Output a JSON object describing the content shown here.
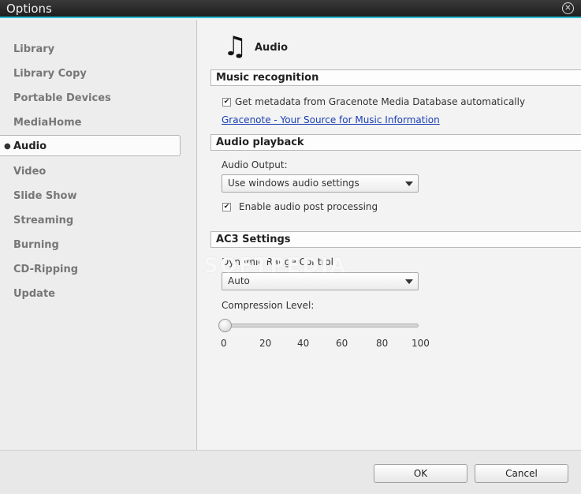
{
  "window": {
    "title": "Options",
    "close_glyph": "✕"
  },
  "sidebar": {
    "items": [
      {
        "label": "Library"
      },
      {
        "label": "Library Copy"
      },
      {
        "label": "Portable Devices"
      },
      {
        "label": "MediaHome"
      },
      {
        "label": "Audio",
        "active": true
      },
      {
        "label": "Video"
      },
      {
        "label": "Slide Show"
      },
      {
        "label": "Streaming"
      },
      {
        "label": "Burning"
      },
      {
        "label": "CD-Ripping"
      },
      {
        "label": "Update"
      }
    ]
  },
  "page": {
    "title": "Audio",
    "icon": "music-note-icon"
  },
  "music_recognition": {
    "heading": "Music recognition",
    "checkbox_label": "Get metadata from Gracenote Media Database automatically",
    "checked": true,
    "link_text": "Gracenote - Your Source for Music Information"
  },
  "audio_playback": {
    "heading": "Audio playback",
    "output_label": "Audio Output:",
    "output_value": "Use windows audio settings",
    "post_processing_label": "Enable audio post processing",
    "post_processing_checked": true
  },
  "ac3": {
    "heading": "AC3 Settings",
    "drc_label": "Dynamic Range Control:",
    "drc_value": "Auto",
    "compression_label": "Compression Level:",
    "compression_value": 0,
    "ticks": [
      "0",
      "20",
      "40",
      "60",
      "80",
      "100"
    ]
  },
  "watermark": "SOFTPEDIA",
  "footer": {
    "ok_label": "OK",
    "cancel_label": "Cancel"
  },
  "colors": {
    "accent": "#2ac0d8",
    "link": "#1a3fb5"
  }
}
